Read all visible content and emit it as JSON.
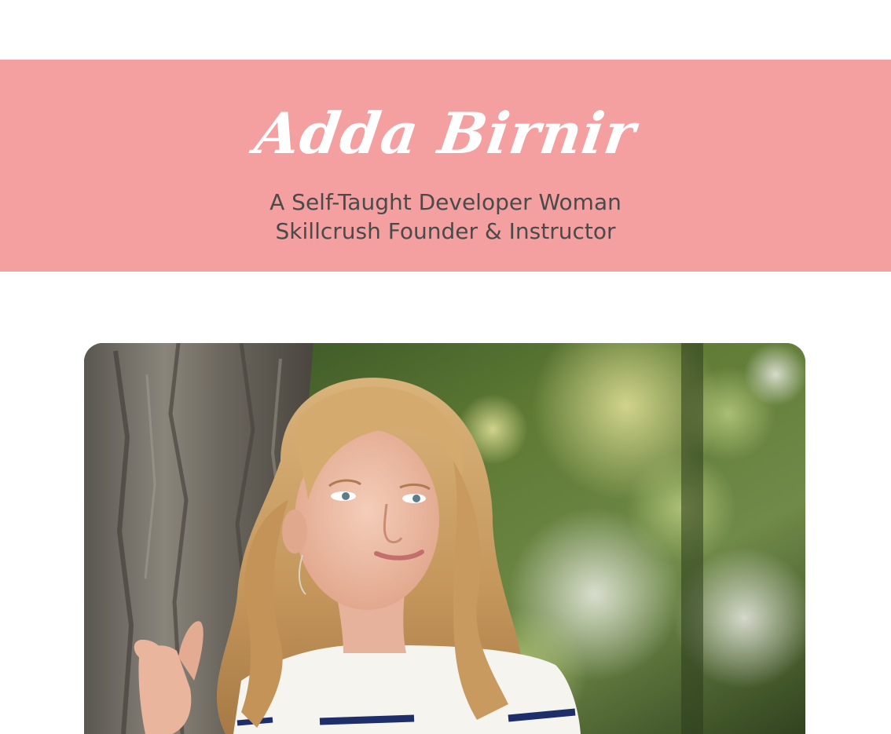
{
  "header": {
    "name": "Adda Birnir",
    "tagline_line1": "A Self-Taught Developer Woman",
    "tagline_line2": "Skillcrush Founder & Instructor"
  },
  "hero_image": {
    "subject": "portrait-photo",
    "description_icon": "portrait-photo-icon"
  },
  "colors": {
    "banner": "#f49fa0",
    "name_text": "#ffffff",
    "tagline_text": "#4a4a4a",
    "page_background": "#ffffff"
  }
}
